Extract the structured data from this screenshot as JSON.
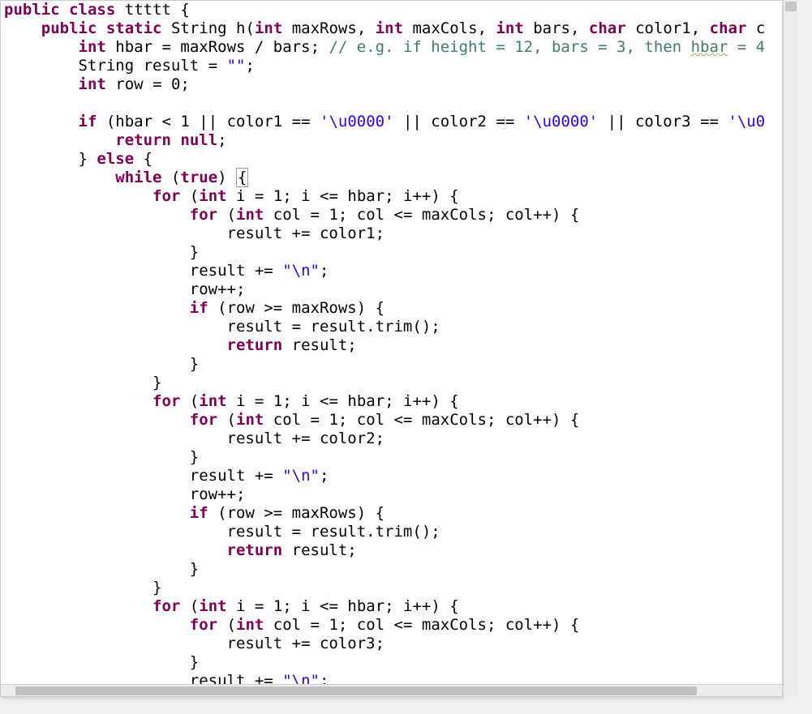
{
  "code": {
    "class_name": "ttttt",
    "method_name": "h",
    "params": [
      {
        "type": "int",
        "name": "maxRows"
      },
      {
        "type": "int",
        "name": "maxCols"
      },
      {
        "type": "int",
        "name": "bars"
      },
      {
        "type": "char",
        "name": "color1"
      },
      {
        "type": "char",
        "name": "c"
      }
    ],
    "hbarCommentPrefix": "// e.g. if height = 12, bars = 3, then ",
    "hbarCommentVar": "hbar",
    "hbarCommentEq": " = 4",
    "strings": {
      "empty": "\"\"",
      "newline": "\"\\n\"",
      "nullChar": "'\\u0000'",
      "nullCharCut": "'\\u0"
    },
    "kw": {
      "public": "public",
      "class": "class",
      "static": "static",
      "int": "int",
      "char": "char",
      "if": "if",
      "else": "else",
      "while": "while",
      "true": "true",
      "for": "for",
      "return": "return",
      "null": "null"
    },
    "ids": {
      "String": "String",
      "hbar": "hbar",
      "maxRows": "maxRows",
      "bars": "bars",
      "result": "result",
      "row": "row",
      "color1": "color1",
      "color2": "color2",
      "color3": "color3",
      "i": "i",
      "col": "col",
      "maxCols": "maxCols",
      "trim": "trim"
    },
    "nums": {
      "zero": "0",
      "one": "1"
    }
  }
}
